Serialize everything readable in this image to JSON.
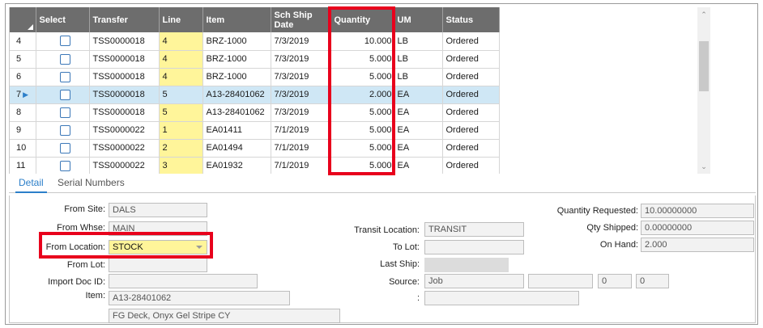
{
  "grid": {
    "columns": [
      "",
      "Select",
      "Transfer",
      "Line",
      "Item",
      "Sch Ship Date",
      "Quantity",
      "UM",
      "Status"
    ],
    "rows": [
      {
        "num": "4",
        "transfer": "TSS0000018",
        "line": "4",
        "item": "BRZ-1000",
        "date": "7/3/2019",
        "qty": "10.000",
        "um": "LB",
        "status": "Ordered"
      },
      {
        "num": "5",
        "transfer": "TSS0000018",
        "line": "4",
        "item": "BRZ-1000",
        "date": "7/3/2019",
        "qty": "5.000",
        "um": "LB",
        "status": "Ordered"
      },
      {
        "num": "6",
        "transfer": "TSS0000018",
        "line": "4",
        "item": "BRZ-1000",
        "date": "7/3/2019",
        "qty": "5.000",
        "um": "LB",
        "status": "Ordered"
      },
      {
        "num": "7",
        "transfer": "TSS0000018",
        "line": "5",
        "item": "A13-28401062",
        "date": "7/3/2019",
        "qty": "2.000",
        "um": "EA",
        "status": "Ordered",
        "selected": true
      },
      {
        "num": "8",
        "transfer": "TSS0000018",
        "line": "5",
        "item": "A13-28401062",
        "date": "7/3/2019",
        "qty": "5.000",
        "um": "EA",
        "status": "Ordered"
      },
      {
        "num": "9",
        "transfer": "TSS0000022",
        "line": "1",
        "item": "EA01411",
        "date": "7/1/2019",
        "qty": "5.000",
        "um": "EA",
        "status": "Ordered"
      },
      {
        "num": "10",
        "transfer": "TSS0000022",
        "line": "2",
        "item": "EA01494",
        "date": "7/1/2019",
        "qty": "5.000",
        "um": "EA",
        "status": "Ordered"
      },
      {
        "num": "11",
        "transfer": "TSS0000022",
        "line": "3",
        "item": "EA01932",
        "date": "7/1/2019",
        "qty": "5.000",
        "um": "EA",
        "status": "Ordered"
      }
    ]
  },
  "tabs": [
    "Detail",
    "Serial Numbers"
  ],
  "detail": {
    "from_site_label": "From Site:",
    "from_site": "DALS",
    "from_whse_label": "From Whse:",
    "from_whse": "MAIN",
    "from_location_label": "From Location:",
    "from_location": "STOCK",
    "from_lot_label": "From Lot:",
    "from_lot": "",
    "import_doc_label": "Import Doc ID:",
    "import_doc": "",
    "item_label": "Item:",
    "item": "A13-28401062",
    "item_desc": "FG Deck, Onyx Gel Stripe CY",
    "transit_label": "Transit Location:",
    "transit": "TRANSIT",
    "to_lot_label": "To Lot:",
    "to_lot": "",
    "last_ship_label": "Last Ship:",
    "source_label": "Source:",
    "source": "Job",
    "source_num1": "0",
    "source_num2": "0",
    "colon_label": ":",
    "qty_req_label": "Quantity Requested:",
    "qty_req": "10.00000000",
    "qty_shipped_label": "Qty Shipped:",
    "qty_shipped": "0.00000000",
    "on_hand_label": "On Hand:",
    "on_hand": "2.000"
  },
  "colors": {
    "highlight": "#e8001c",
    "header_bg": "#6d6d6d",
    "line_bg": "#fff59a",
    "selected_row": "#cfe7f5",
    "accent": "#2c7fc9"
  }
}
